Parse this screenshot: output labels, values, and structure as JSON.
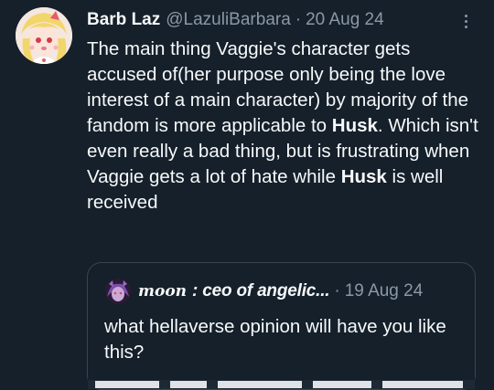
{
  "tweet": {
    "author_name": "Barb Laz",
    "handle": "@LazuliBarbara",
    "separator": "·",
    "date": "20 Aug 24",
    "text_parts": [
      "The main thing Vaggie's character gets accused of(her purpose only being the love interest of a main character) by majority of the fandom is more applicable to ",
      "Husk",
      ". Which isn't even really a bad thing, but is frustrating when Vaggie gets a lot of hate while ",
      "Husk",
      " is well received"
    ],
    "more_icon": "more-horizontal-icon"
  },
  "quote": {
    "author_name_script": "moon",
    "author_name_rest": ": ceo of angelic...",
    "separator": "·",
    "date": "19 Aug 24",
    "text": "what hellaverse opinion will have you like this?"
  },
  "colors": {
    "background": "#15202b",
    "primary_text": "#f7f9f9",
    "secondary_text": "#8b98a5",
    "border": "#38444d"
  }
}
